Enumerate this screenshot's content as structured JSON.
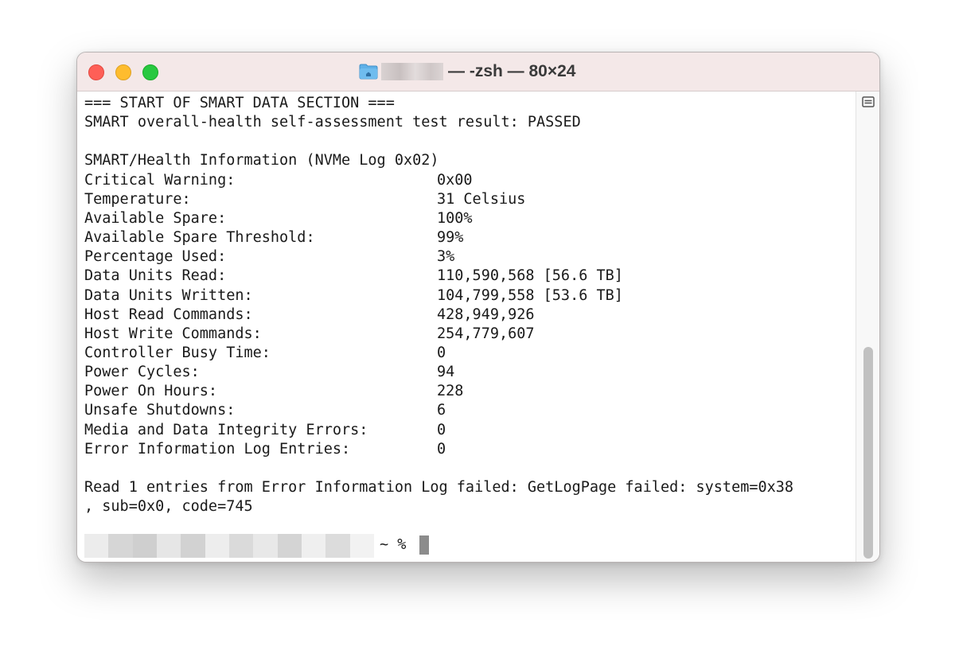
{
  "window": {
    "title": "— -zsh — 80×24",
    "title_icon": "folder-icon"
  },
  "traffic_lights": {
    "close_color": "#fe5f57",
    "minimize_color": "#febc2e",
    "zoom_color": "#28c840"
  },
  "terminal": {
    "header_lines": [
      "=== START OF SMART DATA SECTION ===",
      "SMART overall-health self-assessment test result: PASSED",
      "",
      "SMART/Health Information (NVMe Log 0x02)"
    ],
    "fields": [
      {
        "label": "Critical Warning:",
        "value": "0x00"
      },
      {
        "label": "Temperature:",
        "value": "31 Celsius"
      },
      {
        "label": "Available Spare:",
        "value": "100%"
      },
      {
        "label": "Available Spare Threshold:",
        "value": "99%"
      },
      {
        "label": "Percentage Used:",
        "value": "3%"
      },
      {
        "label": "Data Units Read:",
        "value": "110,590,568 [56.6 TB]"
      },
      {
        "label": "Data Units Written:",
        "value": "104,799,558 [53.6 TB]"
      },
      {
        "label": "Host Read Commands:",
        "value": "428,949,926"
      },
      {
        "label": "Host Write Commands:",
        "value": "254,779,607"
      },
      {
        "label": "Controller Busy Time:",
        "value": "0"
      },
      {
        "label": "Power Cycles:",
        "value": "94"
      },
      {
        "label": "Power On Hours:",
        "value": "228"
      },
      {
        "label": "Unsafe Shutdowns:",
        "value": "6"
      },
      {
        "label": "Media and Data Integrity Errors:",
        "value": "0"
      },
      {
        "label": "Error Information Log Entries:",
        "value": "0"
      }
    ],
    "footer_lines": [
      "",
      "Read 1 entries from Error Information Log failed: GetLogPage failed: system=0x38",
      ", sub=0x0, code=745",
      ""
    ],
    "prompt": "~ %"
  },
  "scrollbar": {
    "icon": "scroll-menu-icon"
  }
}
